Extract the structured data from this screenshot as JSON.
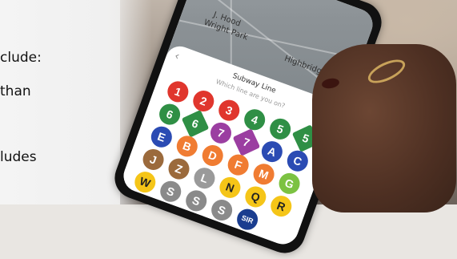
{
  "slide": {
    "fragments": [
      "clude:",
      "than",
      "ludes"
    ]
  },
  "map": {
    "labels": [
      "J. Hood",
      "Wright Park",
      "Highbridge"
    ]
  },
  "sheet": {
    "title": "Subway Line",
    "subtitle": "Which line are you on?"
  },
  "lines": [
    {
      "label": "1",
      "color": "#e0362d"
    },
    {
      "label": "2",
      "color": "#e0362d"
    },
    {
      "label": "3",
      "color": "#e0362d"
    },
    {
      "label": "4",
      "color": "#2f8f45"
    },
    {
      "label": "5",
      "color": "#2f8f45"
    },
    {
      "label": "5",
      "color": "#2f8f45",
      "diamond": true
    },
    {
      "label": "6",
      "color": "#2f8f45"
    },
    {
      "label": "6",
      "color": "#2f8f45",
      "diamond": true
    },
    {
      "label": "7",
      "color": "#9b3ea1"
    },
    {
      "label": "7",
      "color": "#9b3ea1",
      "diamond": true
    },
    {
      "label": "A",
      "color": "#2b4bb3"
    },
    {
      "label": "C",
      "color": "#2b4bb3"
    },
    {
      "label": "E",
      "color": "#2b4bb3"
    },
    {
      "label": "B",
      "color": "#f07c32"
    },
    {
      "label": "D",
      "color": "#f07c32"
    },
    {
      "label": "F",
      "color": "#f07c32"
    },
    {
      "label": "M",
      "color": "#f07c32"
    },
    {
      "label": "G",
      "color": "#7cc242"
    },
    {
      "label": "J",
      "color": "#9b6a3c"
    },
    {
      "label": "Z",
      "color": "#9b6a3c"
    },
    {
      "label": "L",
      "color": "#9a9a9a"
    },
    {
      "label": "N",
      "color": "#f5c518",
      "dark": true
    },
    {
      "label": "Q",
      "color": "#f5c518",
      "dark": true
    },
    {
      "label": "R",
      "color": "#f5c518",
      "dark": true
    },
    {
      "label": "W",
      "color": "#f5c518",
      "dark": true
    },
    {
      "label": "S",
      "color": "#8a8a8a"
    },
    {
      "label": "S",
      "color": "#8a8a8a"
    },
    {
      "label": "S",
      "color": "#8a8a8a"
    },
    {
      "label": "SIR",
      "color": "#1a3d8f"
    }
  ]
}
